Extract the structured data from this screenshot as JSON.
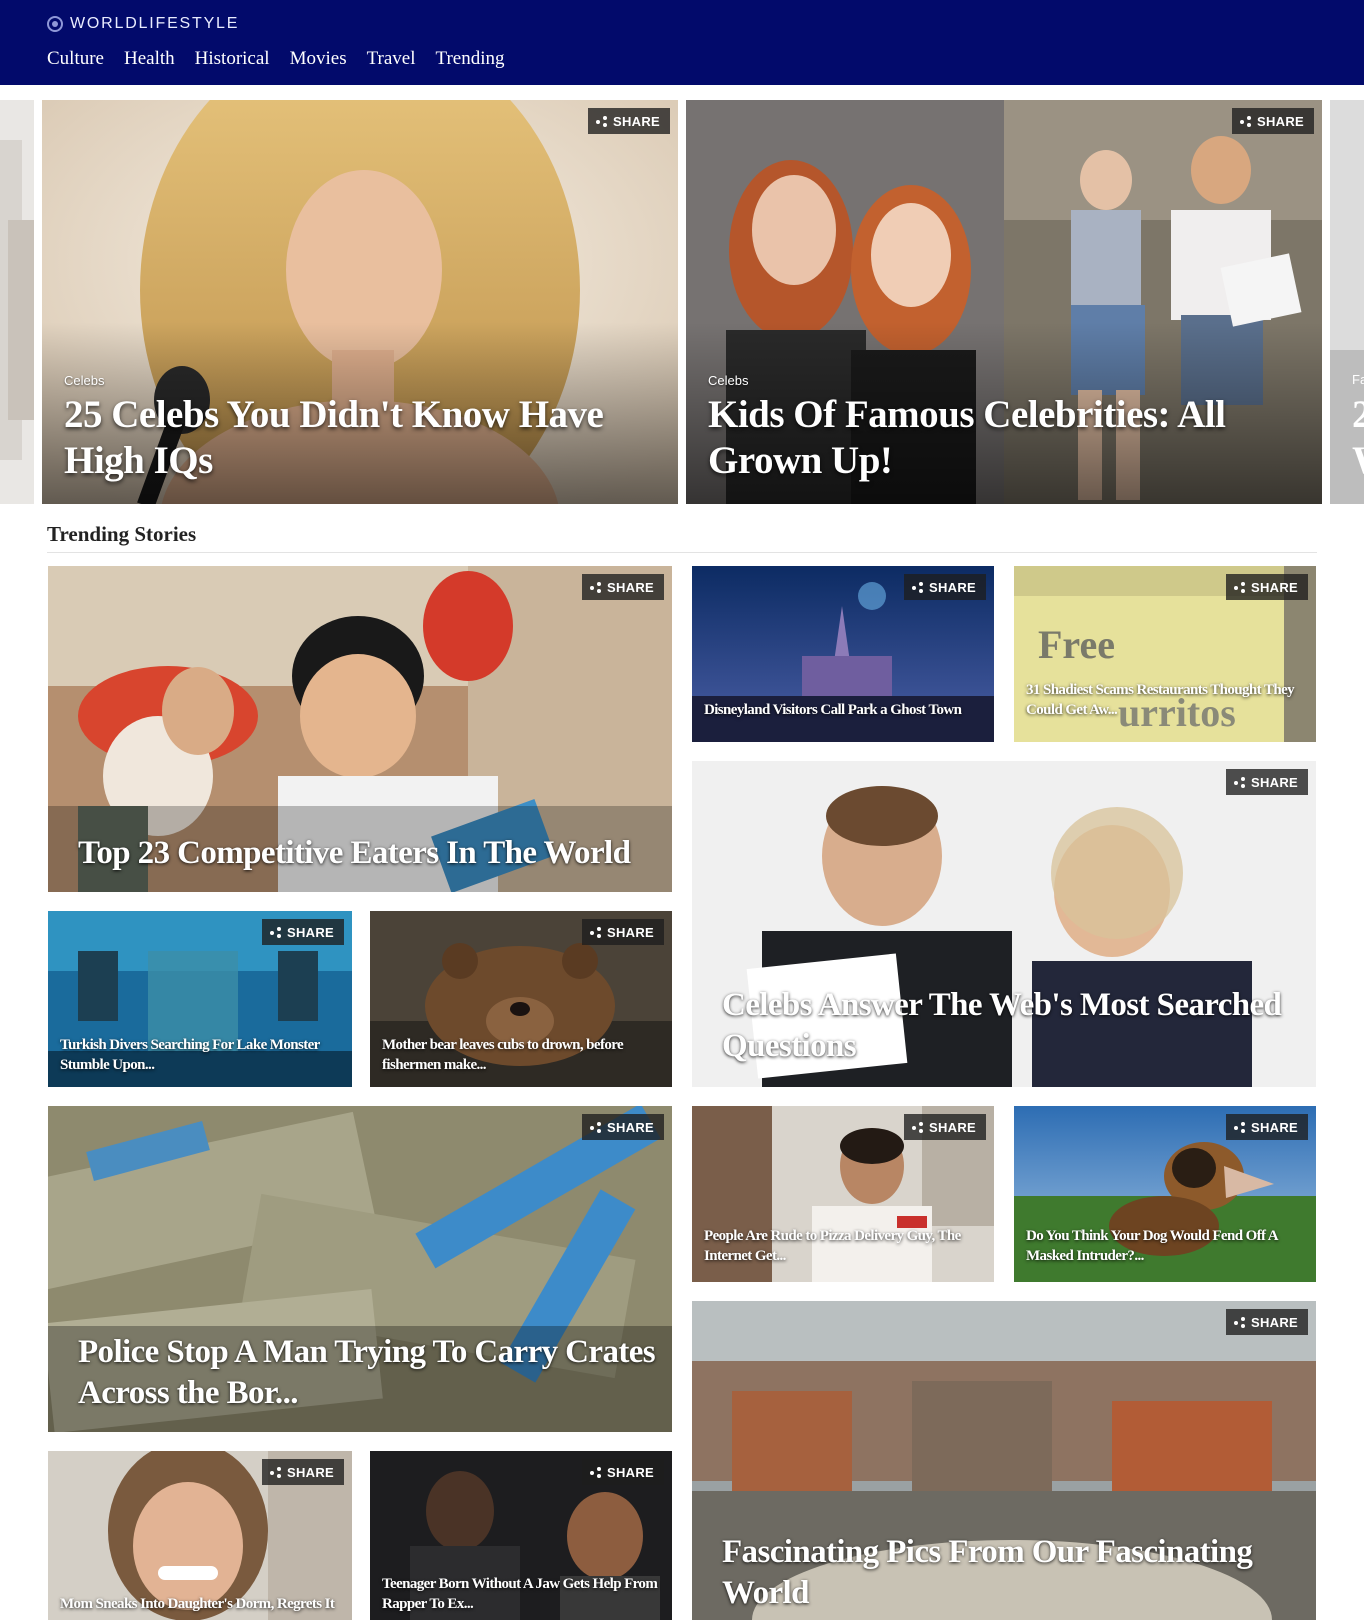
{
  "header": {
    "logo_text": "WORLDLIFESTYLE",
    "nav": [
      "Culture",
      "Health",
      "Historical",
      "Movies",
      "Travel",
      "Trending"
    ]
  },
  "share_label": "SHARE",
  "hero": [
    {
      "category": "Celebs",
      "title": "25 Celebs You Didn't Know Have High IQs"
    },
    {
      "category": "Celebs",
      "title": "Kids Of Famous Celebrities: All Grown Up!"
    }
  ],
  "hero_next_peek": {
    "category": "Fa",
    "title": "2 W"
  },
  "trending": {
    "heading": "Trending Stories",
    "stories": [
      {
        "title": "Top 23 Competitive Eaters In The World"
      },
      {
        "title": "Disneyland Visitors Call Park a Ghost Town"
      },
      {
        "title": "31 Shadiest Scams Restaurants Thought They Could Get Aw..."
      },
      {
        "title": "Celebs Answer The Web's Most Searched Questions"
      },
      {
        "title": "Turkish Divers Searching For Lake Monster Stumble Upon..."
      },
      {
        "title": "Mother bear leaves cubs to drown, before fishermen make..."
      },
      {
        "title": "Police Stop A Man Trying To Carry Crates Across the Bor..."
      },
      {
        "title": "People Are Rude to Pizza Delivery Guy, The Internet Get..."
      },
      {
        "title": "Do You Think Your Dog Would Fend Off A Masked Intruder?..."
      },
      {
        "title": "Fascinating Pics From Our Fascinating World"
      },
      {
        "title": "Mom Sneaks Into Daughter's Dorm, Regrets It"
      },
      {
        "title": "Teenager Born Without A Jaw Gets Help From Rapper To Ex..."
      }
    ]
  },
  "colors": {
    "header_bg": "#020a6b",
    "accent": "#d9001b"
  }
}
